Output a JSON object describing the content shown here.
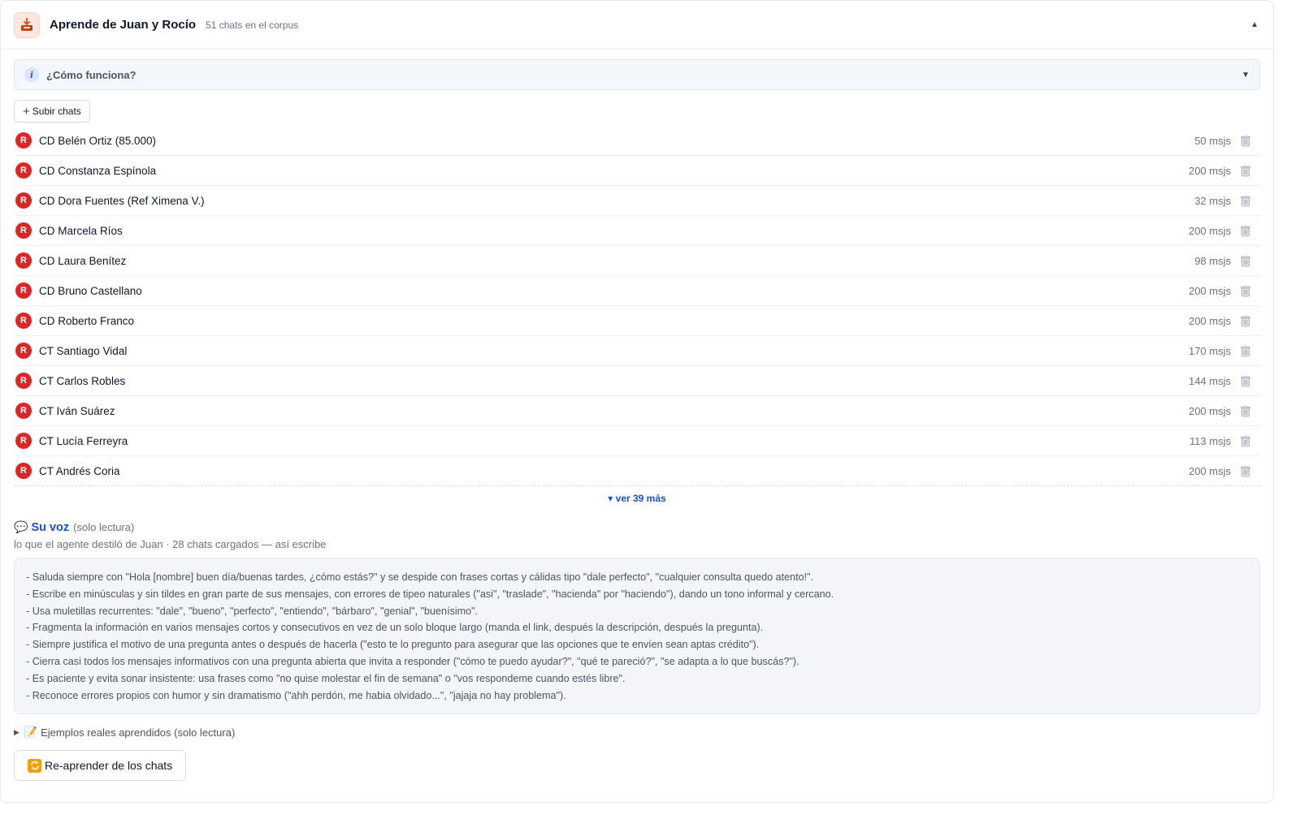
{
  "header": {
    "title": "Aprende de Juan y Rocío",
    "subtitle": "51 chats en el corpus",
    "caret": "▲"
  },
  "info": {
    "icon_glyph": "i",
    "label": "¿Cómo funciona?",
    "caret": "▼"
  },
  "upload": {
    "plus": "+",
    "label": "Subir chats"
  },
  "badge_letter": "R",
  "chats": [
    {
      "name": "CD Belén Ortiz (85.000)",
      "count": "50 msjs"
    },
    {
      "name": "CD Constanza Espínola",
      "count": "200 msjs"
    },
    {
      "name": "CD Dora Fuentes (Ref Ximena V.)",
      "count": "32 msjs"
    },
    {
      "name": "CD Marcela Ríos",
      "count": "200 msjs"
    },
    {
      "name": "CD Laura Benítez",
      "count": "98 msjs"
    },
    {
      "name": "CD Bruno Castellano",
      "count": "200 msjs"
    },
    {
      "name": "CD Roberto Franco",
      "count": "200 msjs"
    },
    {
      "name": "CT Santiago Vidal",
      "count": "170 msjs"
    },
    {
      "name": "CT Carlos Robles",
      "count": "144 msjs"
    },
    {
      "name": "CT Iván Suárez",
      "count": "200 msjs"
    },
    {
      "name": "CT Lucía Ferreyra",
      "count": "113 msjs"
    },
    {
      "name": "CT Andrés Coria",
      "count": "200 msjs"
    }
  ],
  "more_label": "▾ ver 39 más",
  "voice": {
    "emoji": "💬",
    "title": "Su voz",
    "readonly": "(solo lectura)",
    "description": "lo que el agente destiló de Juan · 28 chats cargados — así escribe",
    "lines": [
      "- Saluda siempre con \"Hola [nombre] buen día/buenas tardes, ¿cómo estás?\" y se despide con frases cortas y cálidas tipo \"dale perfecto\", \"cualquier consulta quedo atento!\".",
      "- Escribe en minúsculas y sin tildes en gran parte de sus mensajes, con errores de tipeo naturales (\"asi\", \"traslade\", \"hacienda\" por \"haciendo\"), dando un tono informal y cercano.",
      "- Usa muletillas recurrentes: \"dale\", \"bueno\", \"perfecto\", \"entiendo\", \"bárbaro\", \"genial\", \"buenísimo\".",
      "- Fragmenta la información en varios mensajes cortos y consecutivos en vez de un solo bloque largo (manda el link, después la descripción, después la pregunta).",
      "- Siempre justifica el motivo de una pregunta antes o después de hacerla (\"esto te lo pregunto para asegurar que las opciones que te envíen sean aptas crédito\").",
      "- Cierra casi todos los mensajes informativos con una pregunta abierta que invita a responder (\"cómo te puedo ayudar?\", \"qué te pareció?\", \"se adapta a lo que buscás?\").",
      "- Es paciente y evita sonar insistente: usa frases como \"no quise molestar el fin de semana\" o \"vos respondeme cuando estés libre\".",
      "- Reconoce errores propios con humor y sin dramatismo (\"ahh perdón, me habia olvidado...\", \"jajaja no hay problema\")."
    ]
  },
  "examples": {
    "triangle": "▶",
    "emoji": "📝",
    "label": "Ejemplos reales aprendidos (solo lectura)"
  },
  "relearn": {
    "icon_glyph": "🔁",
    "label": "Re-aprender de los chats"
  },
  "colors": {
    "badge": "#dc2626",
    "link": "#1d4ed8",
    "info_bg": "#f3f6fb",
    "voice_bg": "#f3f5f8"
  }
}
